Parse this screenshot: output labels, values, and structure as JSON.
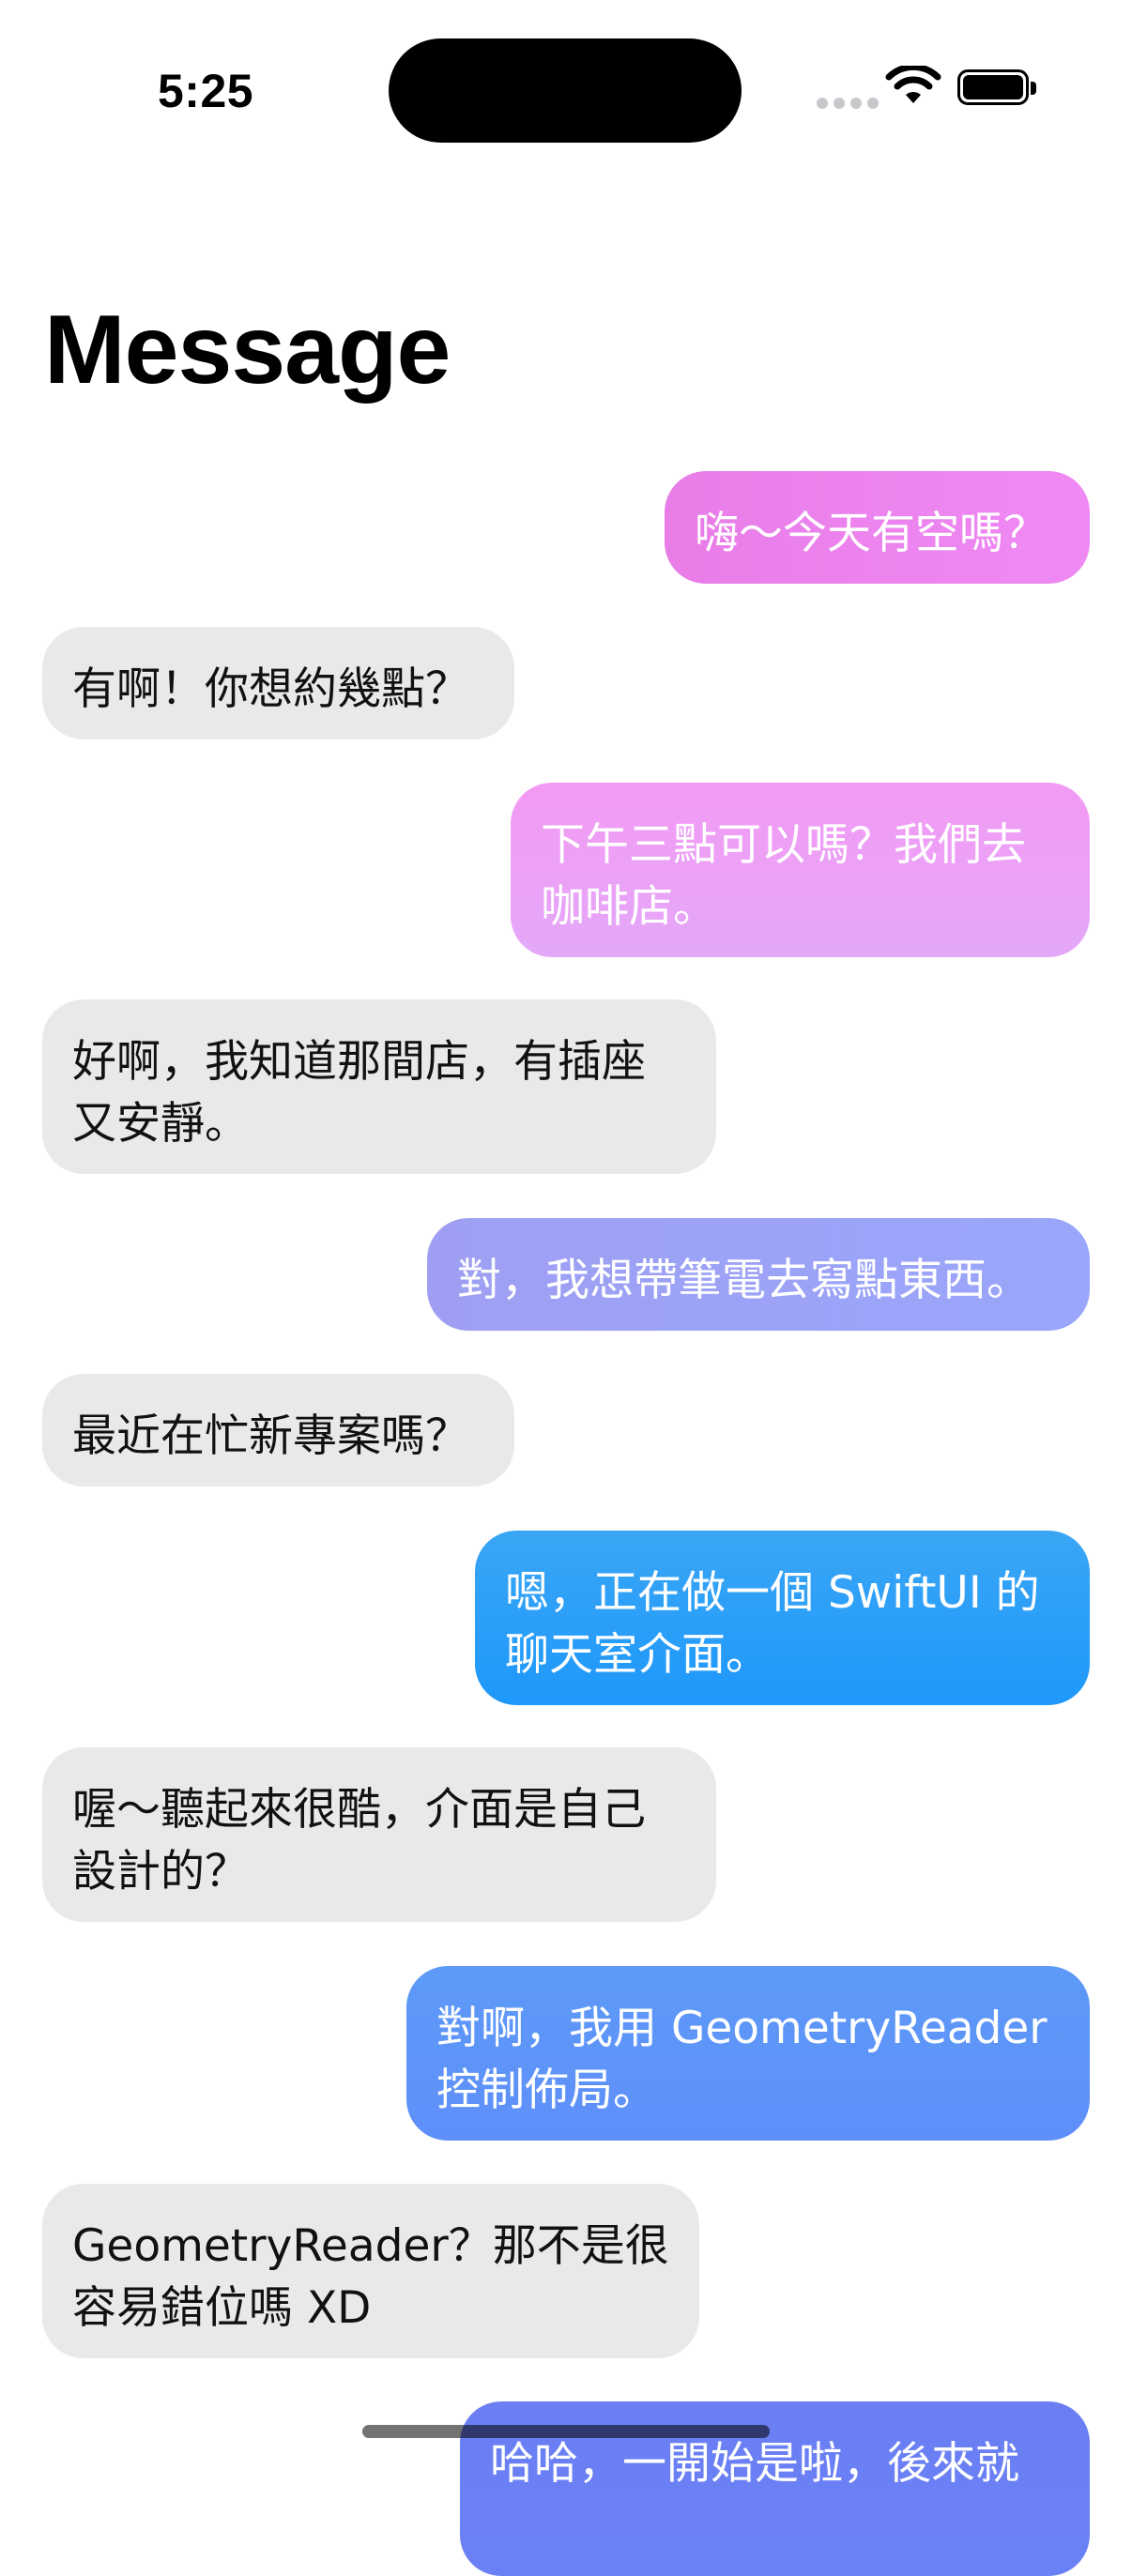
{
  "status_bar": {
    "time": "5:25"
  },
  "header": {
    "title": "Message"
  },
  "messages": [
    {
      "sender": "me",
      "text": "嗨～今天有空嗎？"
    },
    {
      "sender": "other",
      "text": "有啊！你想約幾點？"
    },
    {
      "sender": "me",
      "text": "下午三點可以嗎？我們去咖啡店。"
    },
    {
      "sender": "other",
      "text": "好啊，我知道那間店，有插座又安靜。"
    },
    {
      "sender": "me",
      "text": "對，我想帶筆電去寫點東西。"
    },
    {
      "sender": "other",
      "text": "最近在忙新專案嗎？"
    },
    {
      "sender": "me",
      "text": "嗯，正在做一個 SwiftUI 的聊天室介面。"
    },
    {
      "sender": "other",
      "text": "喔～聽起來很酷，介面是自己設計的？"
    },
    {
      "sender": "me",
      "text": "對啊，我用 GeometryReader 控制佈局。"
    },
    {
      "sender": "other",
      "text": "GeometryReader？那不是很容易錯位嗎 XD"
    },
    {
      "sender": "me",
      "text": "哈哈，一開始是啦，後來就"
    }
  ],
  "colors": {
    "incoming_bubble": "#e9e9e9",
    "outgoing_text": "#ffffff",
    "outgoing_pink": "#ea80ea",
    "outgoing_lavender": "#9ca2f7",
    "outgoing_blue": "#2b9ff8",
    "outgoing_periwinkle": "#5e95f8"
  },
  "icons": {
    "signal": "cellular-signal-icon",
    "wifi": "wifi-icon",
    "battery": "battery-icon"
  }
}
